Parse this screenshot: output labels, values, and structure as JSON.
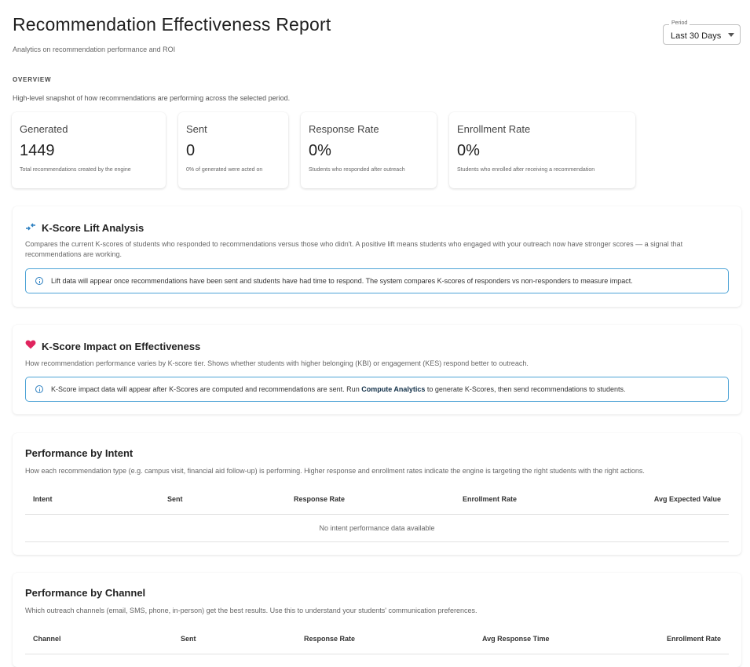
{
  "header": {
    "title": "Recommendation Effectiveness Report",
    "subtitle": "Analytics on recommendation performance and ROI"
  },
  "period": {
    "label": "Period",
    "value": "Last 30 Days"
  },
  "overview": {
    "label": "OVERVIEW",
    "description": "High-level snapshot of how recommendations are performing across the selected period.",
    "cards": [
      {
        "label": "Generated",
        "value": "1449",
        "note": "Total recommendations created by the engine"
      },
      {
        "label": "Sent",
        "value": "0",
        "note": "0% of generated were acted on"
      },
      {
        "label": "Response Rate",
        "value": "0%",
        "note": "Students who responded after outreach"
      },
      {
        "label": "Enrollment Rate",
        "value": "0%",
        "note": "Students who enrolled after receiving a recommendation"
      }
    ]
  },
  "lift": {
    "title": "K-Score Lift Analysis",
    "description": "Compares the current K-scores of students who responded to recommendations versus those who didn't. A positive lift means students who engaged with your outreach now have stronger scores — a signal that recommendations are working.",
    "info": "Lift data will appear once recommendations have been sent and students have had time to respond. The system compares K-scores of responders vs non-responders to measure impact."
  },
  "impact": {
    "title": "K-Score Impact on Effectiveness",
    "description": "How recommendation performance varies by K-score tier. Shows whether students with higher belonging (KBI) or engagement (KES) respond better to outreach.",
    "info_pre": "K-Score impact data will appear after K-Scores are computed and recommendations are sent. Run ",
    "info_bold": "Compute Analytics",
    "info_post": " to generate K-Scores, then send recommendations to students."
  },
  "intent": {
    "title": "Performance by Intent",
    "description": "How each recommendation type (e.g. campus visit, financial aid follow-up) is performing. Higher response and enrollment rates indicate the engine is targeting the right students with the right actions.",
    "columns": [
      "Intent",
      "Sent",
      "Response Rate",
      "Enrollment Rate",
      "Avg Expected Value"
    ],
    "empty": "No intent performance data available"
  },
  "channel": {
    "title": "Performance by Channel",
    "description": "Which outreach channels (email, SMS, phone, in-person) get the best results. Use this to understand your students' communication preferences.",
    "columns": [
      "Channel",
      "Sent",
      "Response Rate",
      "Avg Response Time",
      "Enrollment Rate"
    ]
  },
  "icons": {
    "lift": "trend-arrows-icon",
    "impact": "heart-icon",
    "info": "info-icon"
  },
  "colors": {
    "accent": "#2b7fc0",
    "heart": "#e0245e",
    "info_border": "#4da3d6"
  }
}
